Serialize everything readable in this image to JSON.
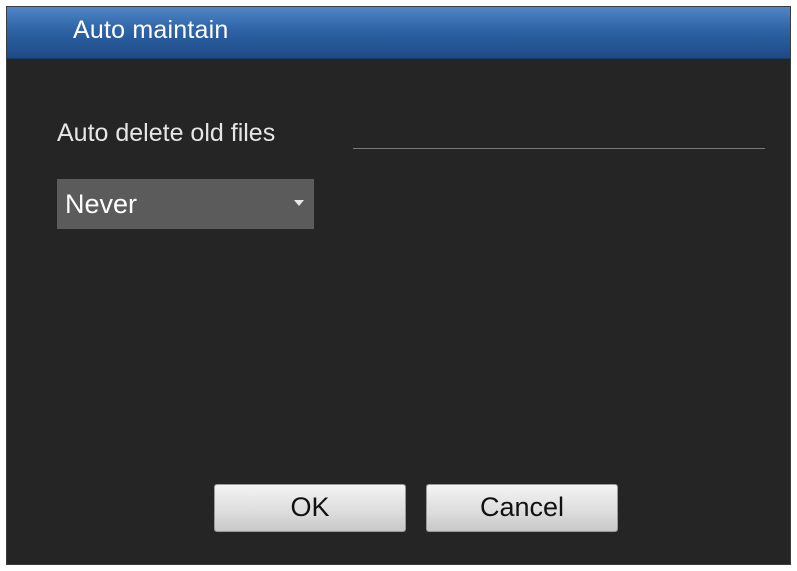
{
  "dialog": {
    "title": "Auto maintain"
  },
  "settings": {
    "section_label": "Auto delete old files",
    "auto_delete": {
      "selected": "Never"
    }
  },
  "buttons": {
    "ok_label": "OK",
    "cancel_label": "Cancel"
  },
  "colors": {
    "titlebar": "#2e63a6",
    "background": "#252525",
    "select_bg": "#5b5b5b"
  },
  "icons": {
    "dropdown": "chevron-down-icon"
  }
}
